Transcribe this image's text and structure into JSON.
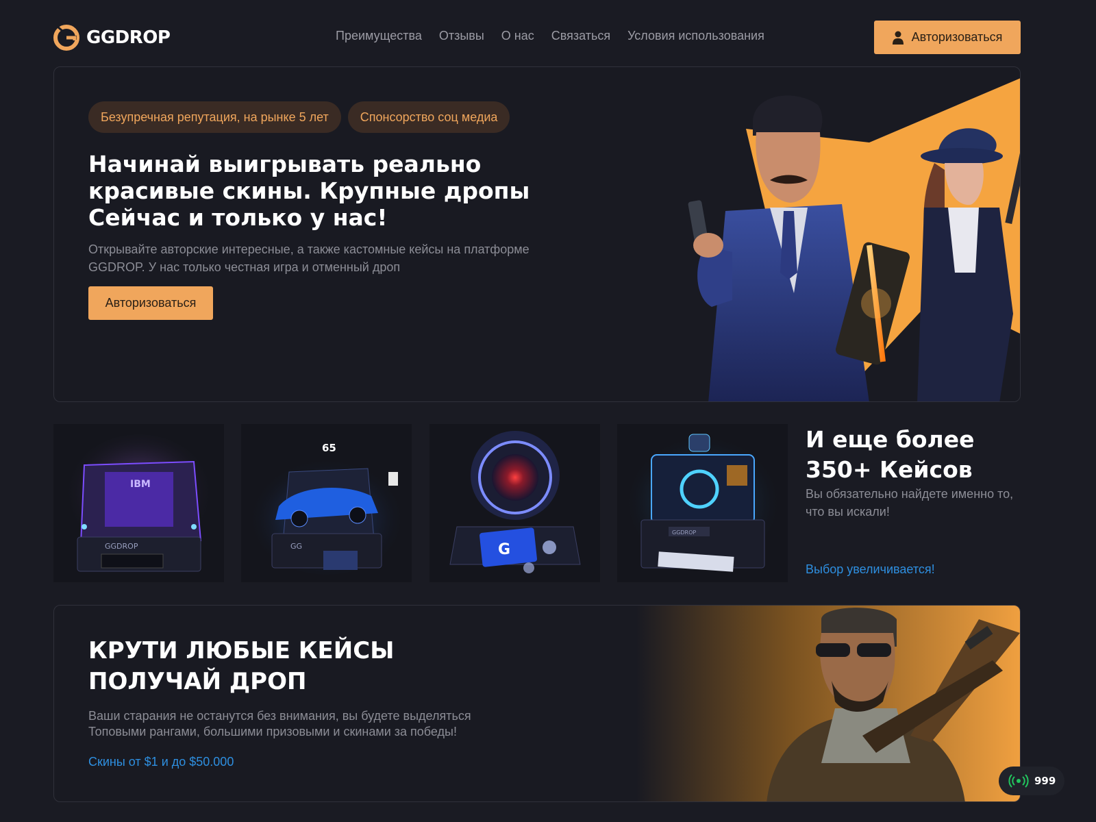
{
  "header": {
    "brand": "GGDROP",
    "nav": [
      "Преимущества",
      "Отзывы",
      "О нас",
      "Связаться",
      "Условия использования"
    ],
    "auth_label": "Авторизоваться"
  },
  "hero": {
    "badges": [
      "Безупречная репутация, на рынке 5 лет",
      "Спонсорство соц медиа"
    ],
    "title": "Начинай выигрывать реально красивые скины. Крупные дропы Сейчас и только у нас!",
    "description": "Открывайте авторские интересные, а также кастомные кейсы на платформе GGDROP. У нас только честная игра и отменный дроп",
    "cta": "Авторизоваться"
  },
  "cases": {
    "items": [
      {
        "name": "IBM",
        "brand": "GGDROP"
      },
      {
        "name": "65",
        "brand": "GG"
      },
      {
        "name": "G"
      },
      {
        "name": "GGDROP"
      }
    ],
    "title": "И еще более 350+ Кейсов",
    "description": "Вы обязательно найдете именно то, что вы искали!",
    "link": "Выбор увеличивается!"
  },
  "promo": {
    "title": "КРУТИ ЛЮБЫЕ КЕЙСЫ ПОЛУЧАЙ ДРОП",
    "description": "Ваши старания не останутся без внимания, вы будете выделяться Топовыми рангами, большими призовыми и скинами за победы!",
    "link": "Скины от $1 и до $50.000"
  },
  "online": {
    "count": "999"
  },
  "colors": {
    "accent": "#f0a65c",
    "link": "#2e8fe0",
    "background": "#1a1b23",
    "online": "#22c55e"
  }
}
